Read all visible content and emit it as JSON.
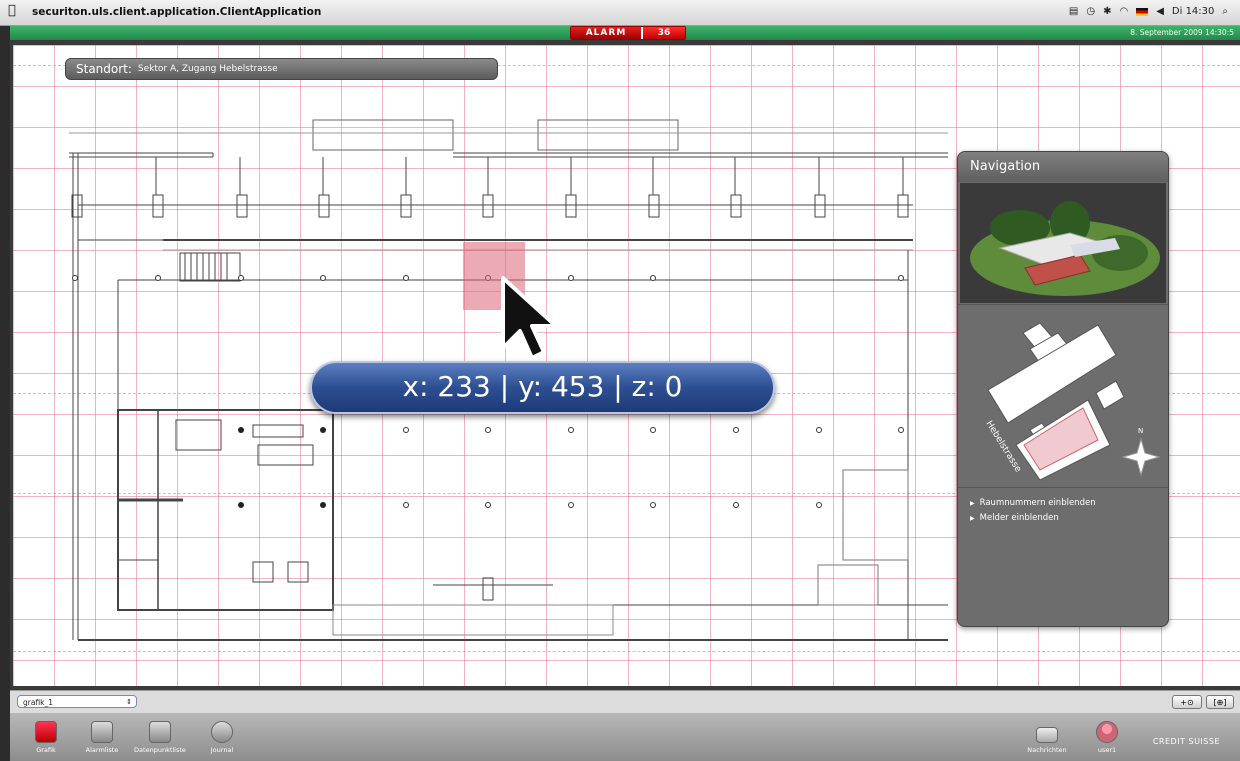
{
  "menubar": {
    "app_name": "securiton.uls.client.application.ClientApplication",
    "clock": "Di 14:30"
  },
  "status": {
    "alarm_label": "ALARM",
    "alarm_count": "36",
    "datetime": "8. September 2009 14:30:5"
  },
  "location": {
    "label": "Standort:",
    "value": "Sektor A, Zugang Hebelstrasse"
  },
  "coordinates": "x: 233 | y: 453 | z: 0",
  "navigation": {
    "title": "Navigation",
    "street_label": "Hebelstrasse",
    "compass": "N",
    "links": [
      "Raumnummern einblenden",
      "Melder einblenden"
    ]
  },
  "view_select": {
    "value": "grafik_1",
    "zoom_a": "+⊙",
    "zoom_b": "[⊕]"
  },
  "toolbar": {
    "items": [
      {
        "label": "Grafik",
        "icon": "grafik-icon"
      },
      {
        "label": "Alarmliste",
        "icon": "alarm-bell-icon"
      },
      {
        "label": "Datenpunktliste",
        "icon": "datapoint-list-icon"
      },
      {
        "label": "Journal",
        "icon": "journal-clock-icon"
      }
    ],
    "messages_label": "Nachrichten",
    "user_label": "user1",
    "brand": "CREDIT SUISSE"
  },
  "colors": {
    "alarm": "#c00000",
    "status_bar": "#2a9a55",
    "grid": "#e6788c",
    "coord_badge": "#2d4f92"
  }
}
